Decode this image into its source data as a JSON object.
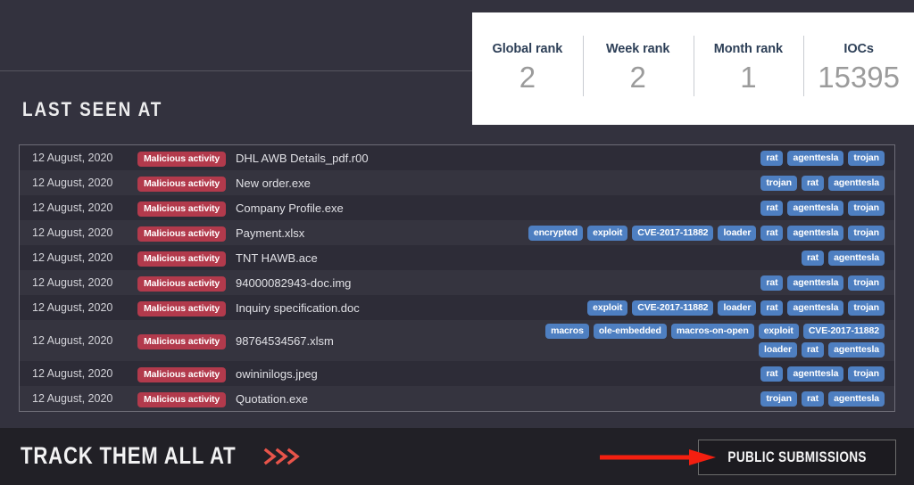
{
  "stats": {
    "cells": [
      {
        "label": "Global rank",
        "value": "2"
      },
      {
        "label": "Week rank",
        "value": "2"
      },
      {
        "label": "Month rank",
        "value": "1"
      },
      {
        "label": "IOCs",
        "value": "15395"
      }
    ]
  },
  "section": {
    "heading": "LAST SEEN AT"
  },
  "table": {
    "rows": [
      {
        "date": "12 August, 2020",
        "verdict": "Malicious activity",
        "file": "DHL AWB Details_pdf.r00",
        "tags": [
          "rat",
          "agenttesla",
          "trojan"
        ]
      },
      {
        "date": "12 August, 2020",
        "verdict": "Malicious activity",
        "file": "New order.exe",
        "tags": [
          "trojan",
          "rat",
          "agenttesla"
        ]
      },
      {
        "date": "12 August, 2020",
        "verdict": "Malicious activity",
        "file": "Company Profile.exe",
        "tags": [
          "rat",
          "agenttesla",
          "trojan"
        ]
      },
      {
        "date": "12 August, 2020",
        "verdict": "Malicious activity",
        "file": "Payment.xlsx",
        "tags": [
          "encrypted",
          "exploit",
          "CVE-2017-11882",
          "loader",
          "rat",
          "agenttesla",
          "trojan"
        ]
      },
      {
        "date": "12 August, 2020",
        "verdict": "Malicious activity",
        "file": "TNT HAWB.ace",
        "tags": [
          "rat",
          "agenttesla"
        ]
      },
      {
        "date": "12 August, 2020",
        "verdict": "Malicious activity",
        "file": "94000082943-doc.img",
        "tags": [
          "rat",
          "agenttesla",
          "trojan"
        ]
      },
      {
        "date": "12 August, 2020",
        "verdict": "Malicious activity",
        "file": "Inquiry specification.doc",
        "tags": [
          "exploit",
          "CVE-2017-11882",
          "loader",
          "rat",
          "agenttesla",
          "trojan"
        ]
      },
      {
        "date": "12 August, 2020",
        "verdict": "Malicious activity",
        "file": "98764534567.xlsm",
        "tags": [
          "macros",
          "ole-embedded",
          "macros-on-open",
          "exploit",
          "CVE-2017-11882",
          "loader",
          "rat",
          "agenttesla"
        ]
      },
      {
        "date": "12 August, 2020",
        "verdict": "Malicious activity",
        "file": "owininilogs.jpeg",
        "tags": [
          "rat",
          "agenttesla",
          "trojan"
        ]
      },
      {
        "date": "12 August, 2020",
        "verdict": "Malicious activity",
        "file": "Quotation.exe",
        "tags": [
          "trojan",
          "rat",
          "agenttesla"
        ]
      }
    ]
  },
  "footer": {
    "track_text": "TRACK THEM ALL AT",
    "chevrons_icon": "triple-chevron-right-icon",
    "button_label": "PUBLIC SUBMISSIONS",
    "arrow_icon": "red-pointer-arrow-icon"
  },
  "colors": {
    "background": "#33332e",
    "footer_background": "#212026",
    "card_background": "#ffffff",
    "verdict_badge": "#b23a4c",
    "tag": "#4e7fc1",
    "accent_red": "#e8544a",
    "stat_label": "#2d3f57",
    "stat_value": "#9b9b9b"
  }
}
